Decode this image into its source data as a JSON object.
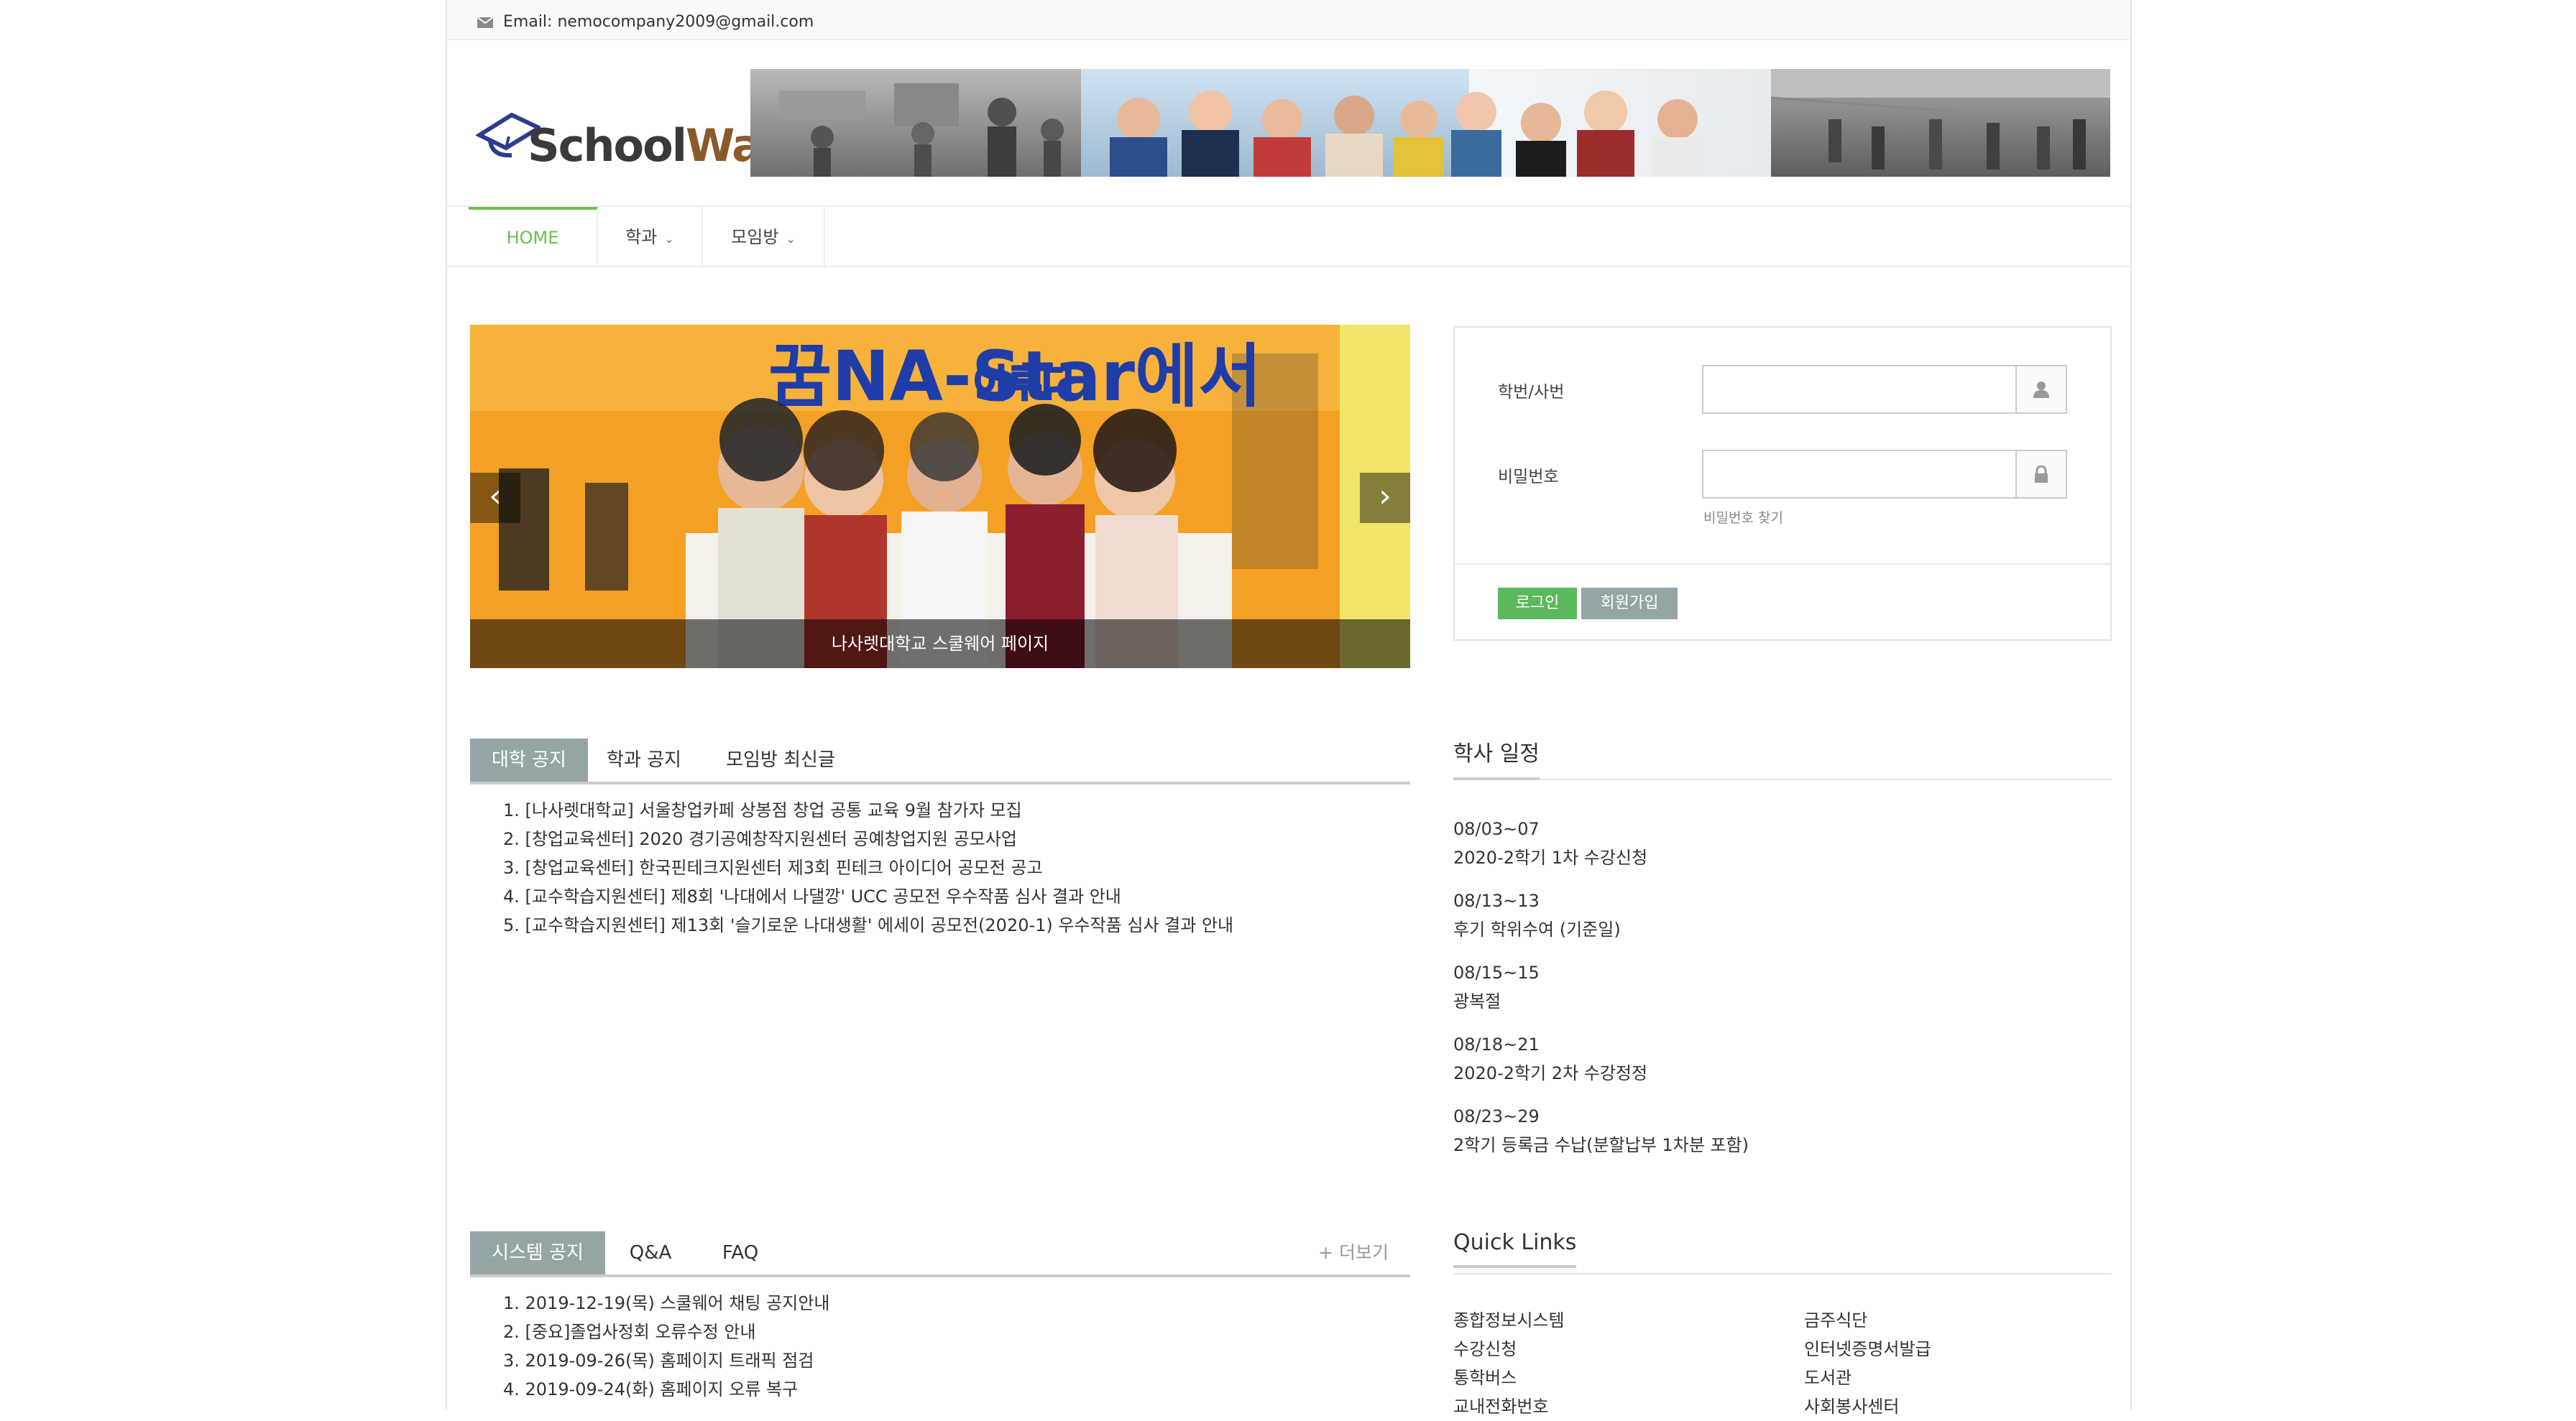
{
  "topbar": {
    "email": "Email: nemocompany2009@gmail.com"
  },
  "logo": {
    "text": "SchoolWare"
  },
  "nav": {
    "items": [
      {
        "label": "HOME",
        "active": true
      },
      {
        "label": "학과",
        "dropdown": true
      },
      {
        "label": "모임방",
        "dropdown": true
      }
    ]
  },
  "carousel": {
    "slide_text_main": "꿈NA-Star에서",
    "slide_text_sub": "이루다",
    "caption": "나사렛대학교 스쿨웨어 페이지",
    "prev_icon": "chevron-left-icon",
    "next_icon": "chevron-right-icon"
  },
  "login": {
    "id_label": "학번/사번",
    "pw_label": "비밀번호",
    "find_pw": "비밀번호 찾기",
    "login_btn": "로그인",
    "signup_btn": "회원가입",
    "colors": {
      "login": "#5cb85c",
      "signup": "#95a5a6"
    }
  },
  "notice": {
    "tabs": [
      "대학 공지",
      "학과 공지",
      "모임방 최신글"
    ],
    "active_tab": "대학 공지",
    "items": [
      "1. [나사렛대학교] 서울창업카페 상봉점 창업 공통 교육 9월 참가자 모집",
      "2. [창업교육센터] 2020 경기공예창작지원센터 공예창업지원 공모사업",
      "3. [창업교육센터] 한국핀테크지원센터 제3회 핀테크 아이디어 공모전 공고",
      "4. [교수학습지원센터] 제8회 '나대에서 나댈깡' UCC 공모전 우수작품 심사 결과 안내",
      "5. [교수학습지원센터] 제13회 '슬기로운 나대생활' 에세이 공모전(2020-1) 우수작품 심사 결과 안내"
    ]
  },
  "schedule": {
    "title": "학사 일정",
    "items": [
      {
        "date": "08/03~07",
        "text": "2020-2학기 1차 수강신청"
      },
      {
        "date": "08/13~13",
        "text": "후기 학위수여 (기준일)"
      },
      {
        "date": "08/15~15",
        "text": "광복절"
      },
      {
        "date": "08/18~21",
        "text": "2020-2학기 2차 수강정정"
      },
      {
        "date": "08/23~29",
        "text": "2학기 등록금 수납(분할납부 1차분 포함)"
      }
    ]
  },
  "system": {
    "tabs": [
      "시스템 공지",
      "Q&A",
      "FAQ"
    ],
    "active_tab": "시스템 공지",
    "more": "+ 더보기",
    "items": [
      "1. 2019-12-19(목) 스쿨웨어 채팅 공지안내",
      "2. [중요]졸업사정회 오류수정 안내",
      "3. 2019-09-26(목) 홈페이지 트래픽 점검",
      "4. 2019-09-24(화) 홈페이지 오류 복구"
    ]
  },
  "quicklinks": {
    "title": "Quick Links",
    "col1": [
      "종합정보시스템",
      "수강신청",
      "통학버스",
      "교내전화번호"
    ],
    "col2": [
      "금주식단",
      "인터넷증명서발급",
      "도서관",
      "사회봉사센터"
    ]
  },
  "colors": {
    "accent": "#6cc04a",
    "tab_active": "#95a5a6"
  }
}
